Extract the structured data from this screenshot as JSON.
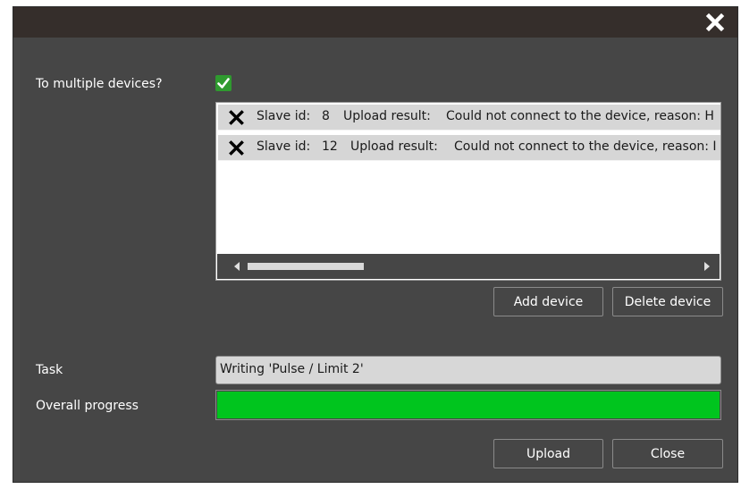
{
  "dialog": {
    "close_icon": "close-icon"
  },
  "form": {
    "multiple_devices_label": "To multiple devices?",
    "multiple_devices_checked": true,
    "task_label": "Task",
    "task_value": "Writing 'Pulse / Limit 2'",
    "progress_label": "Overall progress",
    "progress_fraction": 1.0,
    "progress_color": "#00c51e"
  },
  "device_list": {
    "rows": [
      {
        "status_icon": "error-x-icon",
        "slave_label": "Slave id:",
        "slave_id": "8",
        "result_label": "Upload result:",
        "result_text": "Could not connect to the device, reason: H"
      },
      {
        "status_icon": "error-x-icon",
        "slave_label": "Slave id:",
        "slave_id": "12",
        "result_label": "Upload result:",
        "result_text": "Could not connect to the device, reason: I"
      }
    ]
  },
  "buttons": {
    "add_device": "Add device",
    "delete_device": "Delete device",
    "upload": "Upload",
    "close": "Close"
  }
}
